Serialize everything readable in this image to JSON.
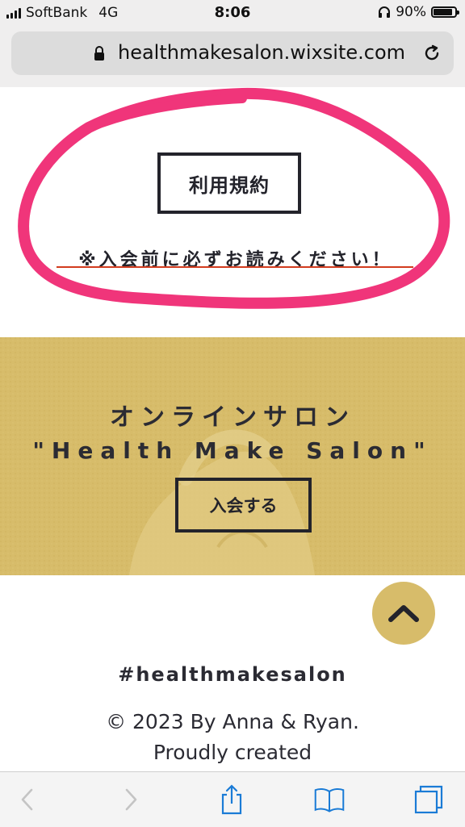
{
  "status_bar": {
    "carrier": "SoftBank",
    "network": "4G",
    "time": "8:06",
    "battery": "90%",
    "battery_level": 0.9
  },
  "browser": {
    "url": "healthmakesalon.wixsite.com"
  },
  "terms": {
    "button_label": "利用規約",
    "notice": "※入会前に必ずお読みください！"
  },
  "banner": {
    "title": "オンラインサロン",
    "subtitle": "\"Health Make Salon\"",
    "join_label": "入会する"
  },
  "footer": {
    "hashtag": "#healthmakesalon",
    "copyright": "© 2023 By Anna & Ryan.",
    "proudly": "Proudly created"
  },
  "colors": {
    "gold": "#d7bc6a",
    "dark": "#23232b",
    "highlight_circle": "#f0357a",
    "underline": "#d23b1e",
    "ios_blue": "#1a7bd6"
  },
  "icons": {
    "back": "chevron-left-icon",
    "forward": "chevron-right-icon",
    "share": "share-icon",
    "bookmarks": "book-icon",
    "tabs": "tabs-icon",
    "scroll_top": "chevron-up-icon"
  }
}
